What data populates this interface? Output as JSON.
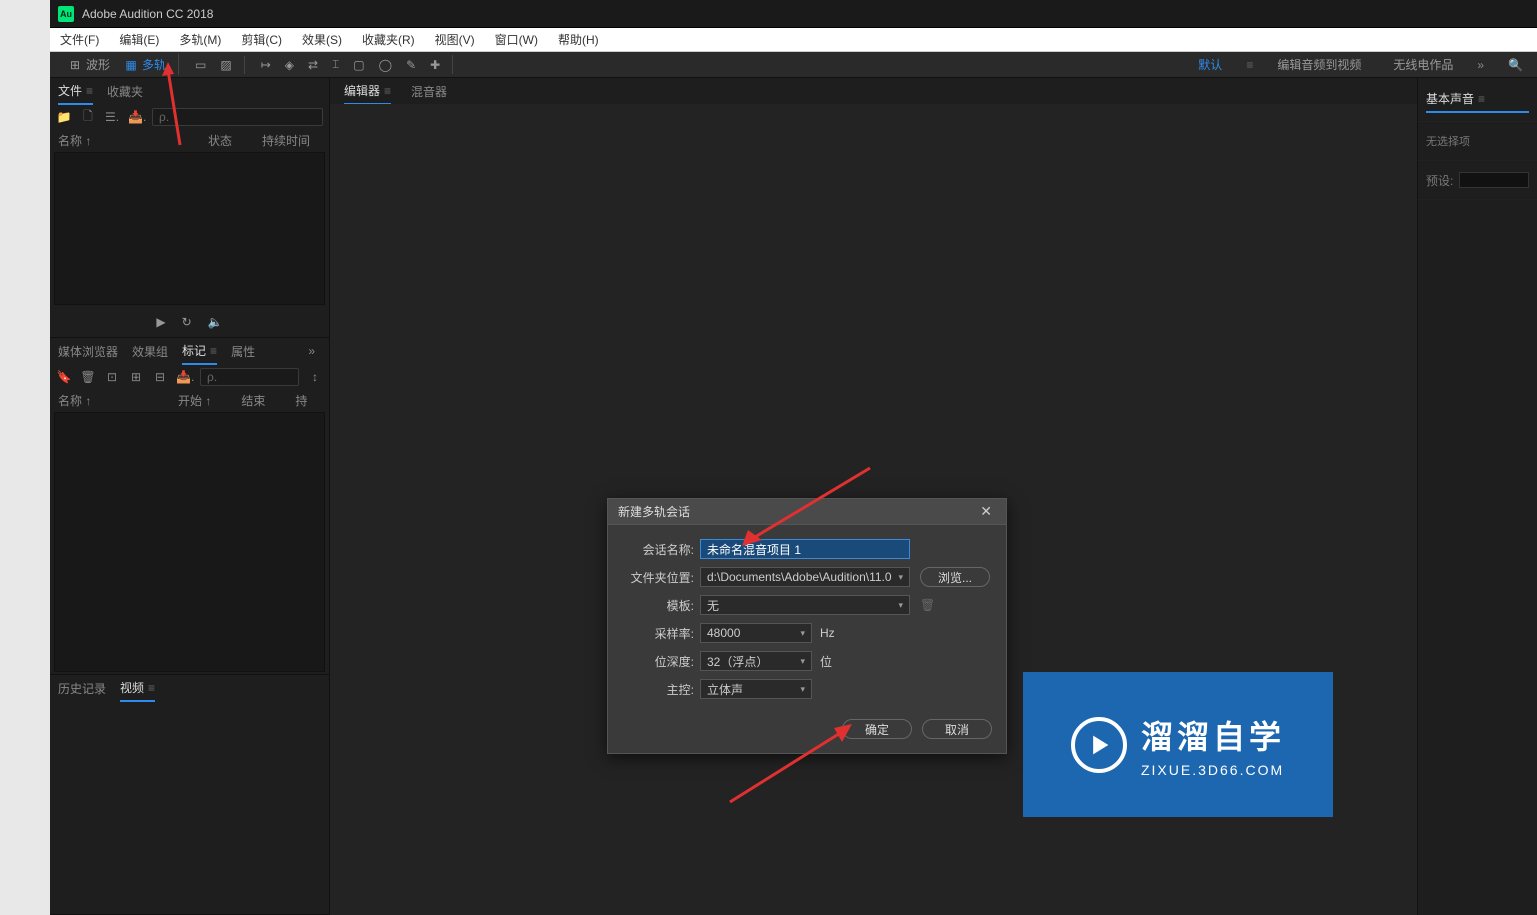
{
  "titlebar": {
    "app_name": "Adobe Audition CC 2018"
  },
  "menubar": [
    "文件(F)",
    "编辑(E)",
    "多轨(M)",
    "剪辑(C)",
    "效果(S)",
    "收藏夹(R)",
    "视图(V)",
    "窗口(W)",
    "帮助(H)"
  ],
  "toolbar": {
    "waveform": "波形",
    "multitrack": "多轨"
  },
  "workspaces": {
    "default": "默认",
    "edit_to_video": "编辑音频到视频",
    "radio": "无线电作品"
  },
  "left": {
    "files_tab": "文件",
    "favorites_tab": "收藏夹",
    "search_placeholder": "ρ.",
    "col_name": "名称 ↑",
    "col_status": "状态",
    "col_duration": "持续时间",
    "media_browser": "媒体浏览器",
    "effects_rack": "效果组",
    "markers": "标记",
    "properties_short": "属性",
    "col_start": "开始 ↑",
    "col_end": "结束",
    "col_hold": "持",
    "history": "历史记录",
    "video": "视频"
  },
  "center": {
    "editor": "编辑器",
    "mixer": "混音器"
  },
  "right": {
    "basic_sound": "基本声音",
    "no_selection": "无选择项",
    "preset": "预设:"
  },
  "dialog": {
    "title": "新建多轨会话",
    "session_name_label": "会话名称:",
    "session_name_value": "未命名混音项目 1",
    "folder_label": "文件夹位置:",
    "folder_value": "d:\\Documents\\Adobe\\Audition\\11.0",
    "browse": "浏览...",
    "template_label": "模板:",
    "template_value": "无",
    "sample_rate_label": "采样率:",
    "sample_rate_value": "48000",
    "sample_rate_unit": "Hz",
    "bit_depth_label": "位深度:",
    "bit_depth_value": "32（浮点）",
    "bit_depth_unit": "位",
    "master_label": "主控:",
    "master_value": "立体声",
    "ok": "确定",
    "cancel": "取消"
  },
  "watermark": {
    "big": "溜溜自学",
    "small": "ZIXUE.3D66.COM"
  }
}
